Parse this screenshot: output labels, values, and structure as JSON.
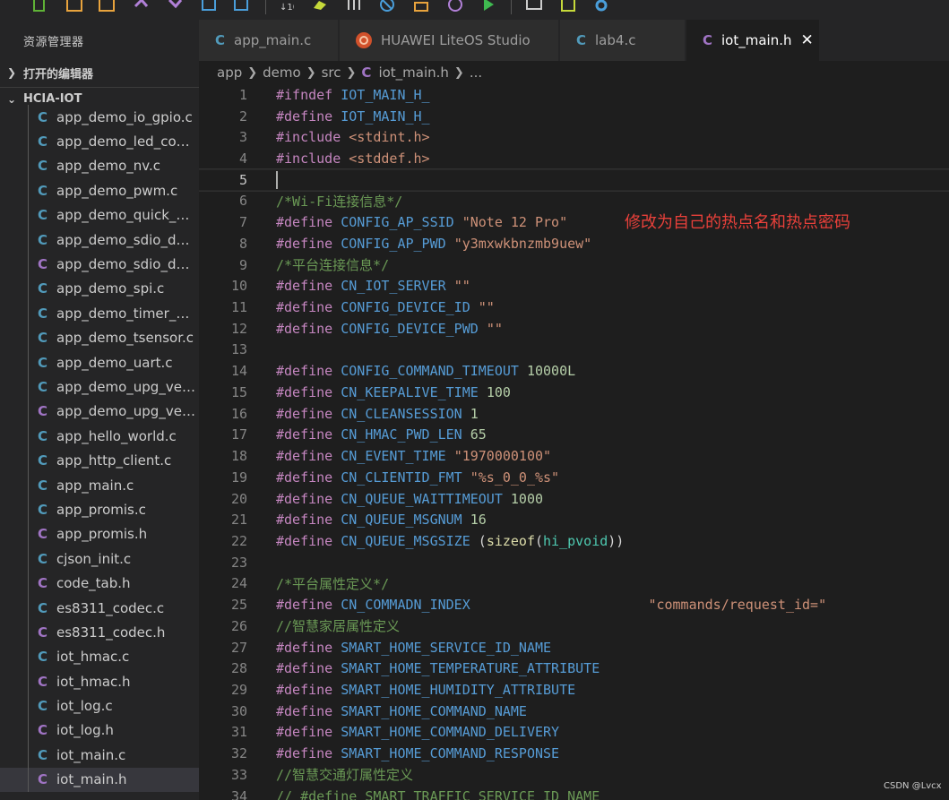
{
  "toolbar": {
    "icons": [
      "new-file-icon",
      "open-folder-icon",
      "save-icon",
      "undo-icon",
      "redo-icon",
      "import-icon",
      "export-icon",
      "sort-icon",
      "build-icon",
      "debug-icon",
      "stop-icon",
      "burn-icon",
      "clock-icon",
      "run-icon",
      "monitor-icon",
      "chip-icon",
      "settings-icon"
    ]
  },
  "sidebar": {
    "title": "资源管理器",
    "section_open": "打开的编辑器",
    "section_project": "HCIA-IOT",
    "files": [
      {
        "name": "app_demo_io_gpio.c",
        "type": "c"
      },
      {
        "name": "app_demo_led_cont...",
        "type": "c"
      },
      {
        "name": "app_demo_nv.c",
        "type": "c"
      },
      {
        "name": "app_demo_pwm.c",
        "type": "c"
      },
      {
        "name": "app_demo_quick_se...",
        "type": "c"
      },
      {
        "name": "app_demo_sdio_dev...",
        "type": "c"
      },
      {
        "name": "app_demo_sdio_dev...",
        "type": "h"
      },
      {
        "name": "app_demo_spi.c",
        "type": "c"
      },
      {
        "name": "app_demo_timer_sy...",
        "type": "c"
      },
      {
        "name": "app_demo_tsensor.c",
        "type": "c"
      },
      {
        "name": "app_demo_uart.c",
        "type": "c"
      },
      {
        "name": "app_demo_upg_veri...",
        "type": "c"
      },
      {
        "name": "app_demo_upg_veri...",
        "type": "h"
      },
      {
        "name": "app_hello_world.c",
        "type": "c"
      },
      {
        "name": "app_http_client.c",
        "type": "c"
      },
      {
        "name": "app_main.c",
        "type": "c"
      },
      {
        "name": "app_promis.c",
        "type": "c"
      },
      {
        "name": "app_promis.h",
        "type": "h"
      },
      {
        "name": "cjson_init.c",
        "type": "c"
      },
      {
        "name": "code_tab.h",
        "type": "h"
      },
      {
        "name": "es8311_codec.c",
        "type": "c"
      },
      {
        "name": "es8311_codec.h",
        "type": "h"
      },
      {
        "name": "iot_hmac.c",
        "type": "c"
      },
      {
        "name": "iot_hmac.h",
        "type": "h"
      },
      {
        "name": "iot_log.c",
        "type": "c"
      },
      {
        "name": "iot_log.h",
        "type": "h"
      },
      {
        "name": "iot_main.c",
        "type": "c"
      },
      {
        "name": "iot_main.h",
        "type": "h",
        "active": true
      }
    ]
  },
  "tabs": [
    {
      "label": "app_main.c",
      "icon": "C",
      "type": "c"
    },
    {
      "label": "HUAWEI LiteOS Studio",
      "icon": "huawei-logo",
      "type": "logo"
    },
    {
      "label": "lab4.c",
      "icon": "C",
      "type": "c"
    },
    {
      "label": "iot_main.h",
      "icon": "C",
      "type": "h",
      "active": true,
      "close": "✕"
    }
  ],
  "breadcrumb": {
    "parts": [
      "app",
      "demo",
      "src"
    ],
    "file_icon": "C",
    "file": "iot_main.h",
    "more": "..."
  },
  "editor": {
    "lines": [
      [
        [
          "kw",
          "#ifndef "
        ],
        [
          "mac",
          "IOT_MAIN_H_"
        ]
      ],
      [
        [
          "kw",
          "#define "
        ],
        [
          "mac",
          "IOT_MAIN_H_"
        ]
      ],
      [
        [
          "kw",
          "#include "
        ],
        [
          "str",
          "<stdint.h>"
        ]
      ],
      [
        [
          "kw",
          "#include "
        ],
        [
          "str",
          "<stddef.h>"
        ]
      ],
      [],
      [
        [
          "cm",
          "/*Wi-Fi连接信息*/"
        ]
      ],
      [
        [
          "kw",
          "#define "
        ],
        [
          "mac",
          "CONFIG_AP_SSID "
        ],
        [
          "str",
          "\"Note 12 Pro\""
        ]
      ],
      [
        [
          "kw",
          "#define "
        ],
        [
          "mac",
          "CONFIG_AP_PWD "
        ],
        [
          "str",
          "\"y3mxwkbnzmb9uew\""
        ]
      ],
      [
        [
          "cm",
          "/*平台连接信息*/"
        ]
      ],
      [
        [
          "kw",
          "#define "
        ],
        [
          "mac",
          "CN_IOT_SERVER "
        ],
        [
          "str",
          "\"\""
        ]
      ],
      [
        [
          "kw",
          "#define "
        ],
        [
          "mac",
          "CONFIG_DEVICE_ID "
        ],
        [
          "str",
          "\"\""
        ]
      ],
      [
        [
          "kw",
          "#define "
        ],
        [
          "mac",
          "CONFIG_DEVICE_PWD "
        ],
        [
          "str",
          "\"\""
        ]
      ],
      [],
      [
        [
          "kw",
          "#define "
        ],
        [
          "mac",
          "CONFIG_COMMAND_TIMEOUT "
        ],
        [
          "num",
          "10000L"
        ]
      ],
      [
        [
          "kw",
          "#define "
        ],
        [
          "mac",
          "CN_KEEPALIVE_TIME "
        ],
        [
          "num",
          "100"
        ]
      ],
      [
        [
          "kw",
          "#define "
        ],
        [
          "mac",
          "CN_CLEANSESSION "
        ],
        [
          "num",
          "1"
        ]
      ],
      [
        [
          "kw",
          "#define "
        ],
        [
          "mac",
          "CN_HMAC_PWD_LEN "
        ],
        [
          "num",
          "65"
        ]
      ],
      [
        [
          "kw",
          "#define "
        ],
        [
          "mac",
          "CN_EVENT_TIME "
        ],
        [
          "str",
          "\"1970000100\""
        ]
      ],
      [
        [
          "kw",
          "#define "
        ],
        [
          "mac",
          "CN_CLIENTID_FMT "
        ],
        [
          "str",
          "\"%s_0_0_%s\""
        ]
      ],
      [
        [
          "kw",
          "#define "
        ],
        [
          "mac",
          "CN_QUEUE_WAITTIMEOUT "
        ],
        [
          "num",
          "1000"
        ]
      ],
      [
        [
          "kw",
          "#define "
        ],
        [
          "mac",
          "CN_QUEUE_MSGNUM "
        ],
        [
          "num",
          "16"
        ]
      ],
      [
        [
          "kw",
          "#define "
        ],
        [
          "mac",
          "CN_QUEUE_MSGSIZE "
        ],
        [
          "pl",
          "("
        ],
        [
          "fn",
          "sizeof"
        ],
        [
          "pl",
          "("
        ],
        [
          "ty",
          "hi_pvoid"
        ],
        [
          "pl",
          "))"
        ]
      ],
      [],
      [
        [
          "cm",
          "/*平台属性定义*/"
        ]
      ],
      [
        [
          "kw",
          "#define "
        ],
        [
          "mac",
          "CN_COMMADN_INDEX"
        ],
        [
          "pl",
          "                      "
        ],
        [
          "str",
          "\"commands/request_id=\""
        ]
      ],
      [
        [
          "cm",
          "//智慧家居属性定义"
        ]
      ],
      [
        [
          "kw",
          "#define "
        ],
        [
          "mac",
          "SMART_HOME_SERVICE_ID_NAME"
        ]
      ],
      [
        [
          "kw",
          "#define "
        ],
        [
          "mac",
          "SMART_HOME_TEMPERATURE_ATTRIBUTE"
        ]
      ],
      [
        [
          "kw",
          "#define "
        ],
        [
          "mac",
          "SMART_HOME_HUMIDITY_ATTRIBUTE"
        ]
      ],
      [
        [
          "kw",
          "#define "
        ],
        [
          "mac",
          "SMART_HOME_COMMAND_NAME"
        ]
      ],
      [
        [
          "kw",
          "#define "
        ],
        [
          "mac",
          "SMART_HOME_COMMAND_DELIVERY"
        ]
      ],
      [
        [
          "kw",
          "#define "
        ],
        [
          "mac",
          "SMART_HOME_COMMAND_RESPONSE"
        ]
      ],
      [
        [
          "cm",
          "//智慧交通灯属性定义"
        ]
      ],
      [
        [
          "cm",
          "// #define SMART_TRAFFIC_SERVICE_ID_NAME"
        ]
      ]
    ],
    "cursor_line": 5
  },
  "annotation": "修改为自己的热点名和热点密码",
  "watermark": "CSDN @Lvcx"
}
